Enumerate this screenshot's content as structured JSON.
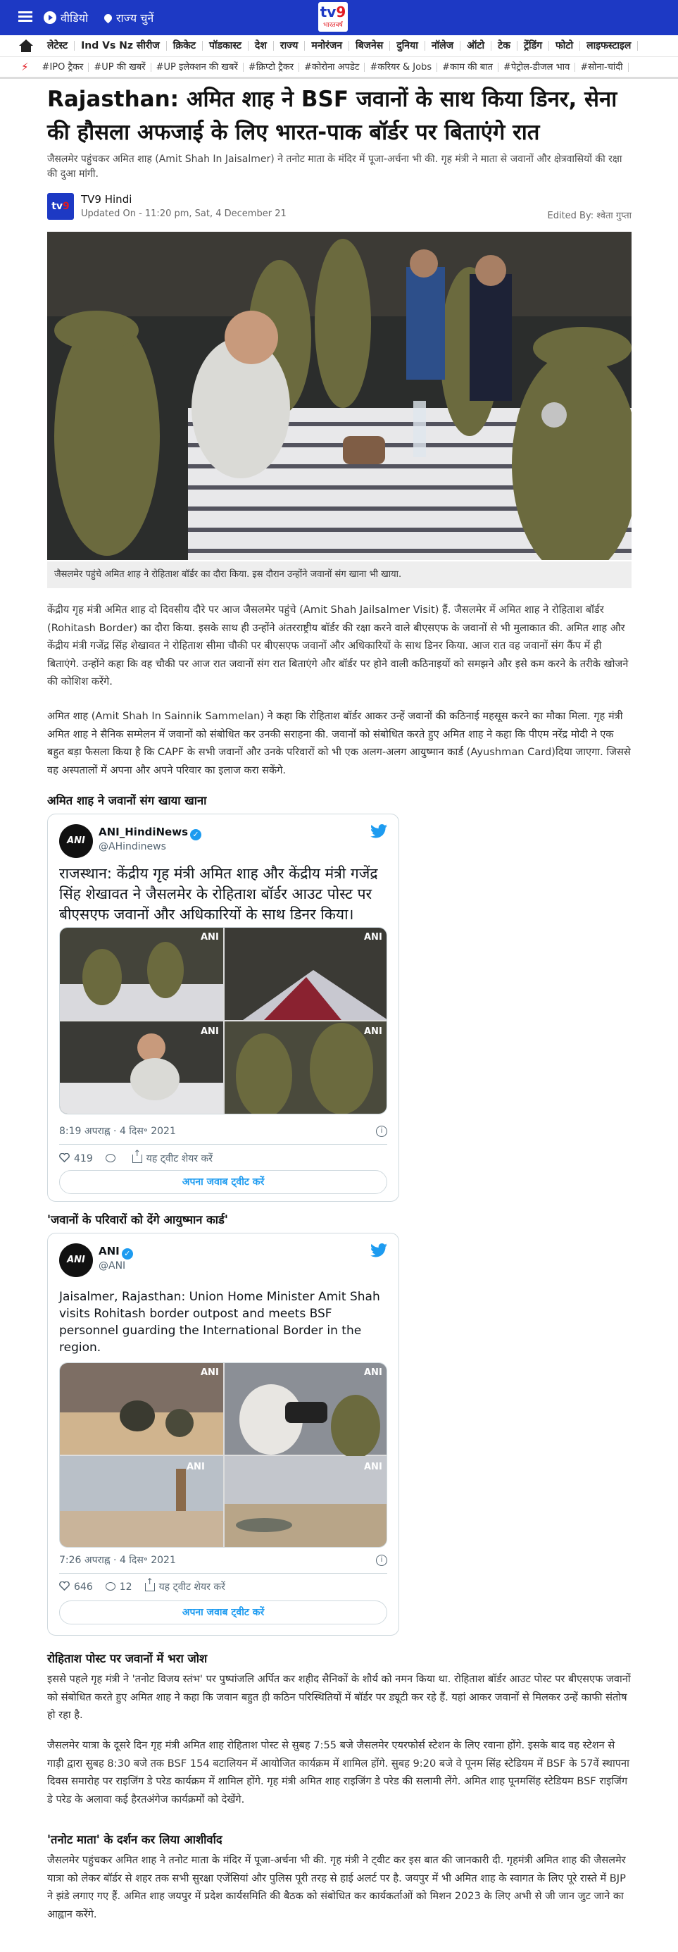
{
  "header": {
    "video_label": "वीडियो",
    "state_label": "राज्य चुनें",
    "logo_main": "tv9",
    "logo_sub": "भारतवर्ष"
  },
  "nav": [
    "लेटेस्ट",
    "Ind Vs Nz सीरीज",
    "क्रिकेट",
    "पॉडकास्ट",
    "देश",
    "राज्य",
    "मनोरंजन",
    "बिजनेस",
    "दुनिया",
    "नॉलेज",
    "ऑटो",
    "टेक",
    "ट्रेंडिंग",
    "फोटो",
    "लाइफस्टाइल"
  ],
  "tags": [
    "#IPO ट्रैकर",
    "#UP की खबरें",
    "#UP इलेक्शन की खबरें",
    "#क्रिप्टो ट्रैकर",
    "#कोरोना अपडेट",
    "#करियर & Jobs",
    "#काम की बात",
    "#पेट्रोल-डीजल भाव",
    "#सोना-चांदी"
  ],
  "article": {
    "title": "Rajasthan: अमित शाह ने BSF जवानों के साथ किया डिनर, सेना की हौसला अफजाई के लिए भारत-पाक बॉर्डर पर बिताएंगे रात",
    "summary": "जैसलमेर पहुंचकर अमित शाह (Amit Shah In Jaisalmer) ने तनोट माता के मंदिर में पूजा-अर्चना भी की. गृह मंत्री ने माता से जवानों और क्षेत्रवासियों की रक्षा की दुआ मांगी.",
    "author": "TV9 Hindi",
    "updated": "Updated On - 11:20 pm, Sat, 4 December 21",
    "edited_by": "Edited By: श्वेता गुप्ता",
    "image_caption": "जैसलमेर पहुंचे अमित शाह ने रोहिताश बॉर्डर का दौरा किया. इस दौरान उन्होंने जवानों संग खाना भी खाया.",
    "para1": "केंद्रीय गृह मंत्री अमित शाह दो दिवसीय दौरे पर आज जैसलमेर पहुंचे (Amit Shah Jailsalmer Visit) हैं. जैसलमेर में अमित शाह ने रोहिताश बॉर्डर (Rohitash Border) का दौरा किया. इसके साथ ही उन्होंने अंतरराष्ट्रीय बॉर्डर की रक्षा करने वाले बीएसएफ के जवानों से भी मुलाकात की. अमित शाह और केंद्रीय मंत्री गजेंद्र सिंह शेखावत ने रोहिताश सीमा चौकी पर बीएसएफ जवानों और अधिकारियों के साथ डिनर किया. आज रात वह जवानों संग कैंप में ही बिताएंगे. उन्होंने कहा कि वह चौकी पर आज रात जवानों संग रात बिताएंगे और बॉर्डर पर होने वाली कठिनाइयों को समझने और इसे कम करने के तरीके खोजने की कोशिश करेंगे.",
    "para2": "अमित शाह (Amit Shah In Sainnik Sammelan) ने कहा कि रोहिताश बॉर्डर आकर उन्हें जवानों की कठिनाई महसूस करने का मौका मिला. गृह मंत्री अमित शाह ने सैनिक सम्मेलन में जवानों को संबोधित कर उनकी सराहना की. जवानों को संबोधित करते हुए अमित शाह ने कहा कि पीएम नरेंद्र मोदी ने एक बहुत बड़ा फैसला किया है कि CAPF के सभी जवानों और उनके परिवारों को भी एक अलग-अलग आयुष्मान कार्ड (Ayushman Card)दिया जाएगा. जिससे वह अस्पतालों में अपना और अपने परिवार का इलाज करा सकेंगे.",
    "heading1": "अमित शाह ने जवानों संग खाया खाना",
    "heading2": "'जवानों के परिवारों को देंगे आयुष्मान कार्ड'",
    "heading3": "रोहिताश पोस्ट पर जवानों में भरा जोश",
    "para3": "इससे पहले गृह मंत्री ने 'तनोट विजय स्तंभ' पर पुष्पांजलि अर्पित कर शहीद सैनिकों के शौर्य को नमन किया था. रोहिताश बॉर्डर आउट पोस्ट पर बीएसएफ जवानों को संबोधित करते हुए अमित शाह ने कहा कि जवान बहुत ही कठिन परिस्थितियों में बॉर्डर पर ड्यूटी कर रहे हैं. यहां आकर जवानों से मिलकर उन्हें काफी संतोष हो रहा है.",
    "para4": "जैसलमेर यात्रा के दूसरे दिन गृह मंत्री अमित शाह रोहिताश पोस्ट से सुबह 7:55 बजे जैसलमेर एयरफोर्स स्टेशन के लिए रवाना होंगे. इसके बाद वह स्टेशन से गाड़ी द्वारा सुबह 8:30 बजे तक BSF 154 बटालियन में आयोजित कार्यक्रम में शामिल होंगे. सुबह 9:20 बजे वे पूनम सिंह स्टेडियम में BSF के 57वें स्थापना दिवस समारोह पर राइजिंग डे परेड कार्यक्रम में शामिल होंगे. गृह मंत्री अमित शाह राइजिंग डे परेड की सलामी लेंगे. अमित शाह पूनमसिंह स्टेडियम BSF राइजिंग डे परेड के अलावा कई हैरतअंगेज कार्यक्रमों को देखेंगे.",
    "heading4": "'तनोट माता' के दर्शन कर लिया आशीर्वाद",
    "para5": "जैसलमेर पहुंचकर अमित शाह ने तनोट माता के मंदिर में पूजा-अर्चना भी की. गृह मंत्री ने ट्वीट कर इस बात की जानकारी दी. गृहमंत्री अमित शाह की जैसलमेर यात्रा को लेकर बॉर्डर से शहर तक सभी सुरक्षा एजेंसियां और पुलिस पूरी तरह से हाई अलर्ट पर है. जयपुर में भी अमित शाह के स्वागत के लिए पूरे रास्ते में BJP ने झंडे लगाए गए हैं. अमित शाह जयपुर में प्रदेश कार्यसमिति की बैठक को संबोधित कर कार्यकर्ताओं को मिशन 2023 के लिए अभी से जी जान जुट जाने का आह्वान करेंगे."
  },
  "tweet1": {
    "avatar": "ANI",
    "name": "ANI_HindiNews",
    "handle": "@AHindinews",
    "text": "राजस्थान: केंद्रीय गृह मंत्री अमित शाह और केंद्रीय मंत्री गजेंद्र सिंह शेखावत ने जैसलमेर के रोहिताश बॉर्डर आउट पोस्ट पर बीएसएफ जवानों और अधिकारियों के साथ डिनर किया।",
    "watermark": "ANI",
    "time": "8:19 अपराह्न · 4 दिस॰ 2021",
    "likes": "419",
    "share": "यह ट्वीट शेयर करें",
    "reply": "अपना जवाब ट्वीट करें"
  },
  "tweet2": {
    "avatar": "ANI",
    "name": "ANI",
    "handle": "@ANI",
    "text": "Jaisalmer, Rajasthan: Union Home Minister Amit Shah visits Rohitash border outpost and meets BSF personnel guarding the International Border in the region.",
    "watermark": "ANI",
    "time": "7:26 अपराह्न · 4 दिस॰ 2021",
    "likes": "646",
    "replies": "12",
    "share": "यह ट्वीट शेयर करें",
    "reply": "अपना जवाब ट्वीट करें"
  },
  "colors": {
    "brand": "#1d39c4",
    "accent": "#e21b22",
    "twitter": "#1d9bf0"
  }
}
